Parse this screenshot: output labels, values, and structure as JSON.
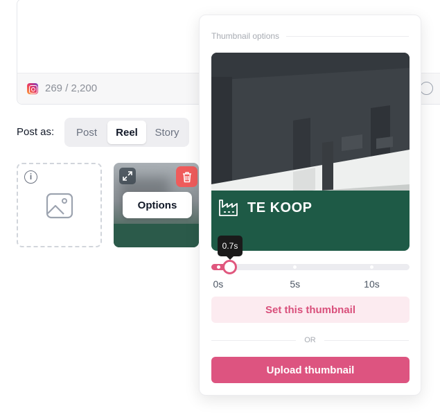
{
  "composer": {
    "char_count": "269 / 2,200",
    "network_icon": "instagram-icon"
  },
  "post_as": {
    "label": "Post as:",
    "options": [
      "Post",
      "Reel",
      "Story"
    ],
    "selected": "Reel"
  },
  "media": {
    "empty_slot_icon": "image-placeholder-icon",
    "info_icon": "info-icon",
    "options_label": "Options",
    "expand_icon": "expand-icon",
    "delete_icon": "trash-icon"
  },
  "thumbnail_popover": {
    "title": "Thumbnail options",
    "preview_sign_text": "TE KOOP",
    "current_time": "0.7s",
    "slider": {
      "value_seconds": 0.7,
      "max_seconds": 12,
      "ticks": [
        "0s",
        "5s",
        "10s"
      ],
      "tick_values": [
        0,
        5,
        10
      ]
    },
    "set_button": "Set this thumbnail",
    "divider_text": "OR",
    "upload_button": "Upload thumbnail"
  },
  "colors": {
    "accent": "#dd5480",
    "accent_soft": "#fcebf0",
    "danger": "#ef5b5b",
    "sign_green": "#1e5a46"
  }
}
